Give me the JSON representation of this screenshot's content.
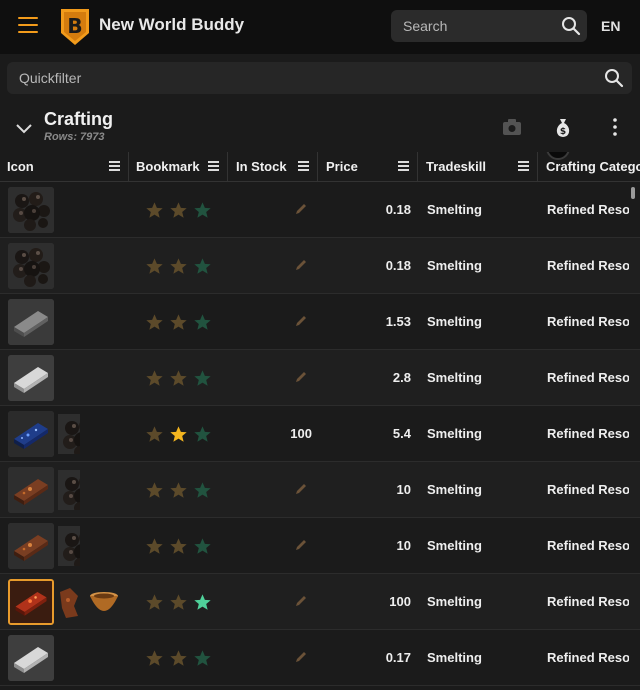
{
  "app": {
    "title": "New World Buddy",
    "lang": "EN",
    "search_placeholder": "Search",
    "quickfilter_placeholder": "Quickfilter",
    "accent": "#f29b1b"
  },
  "section": {
    "title": "Crafting",
    "rows_text": "Rows: 7973"
  },
  "columns": [
    {
      "label": "Icon"
    },
    {
      "label": "Bookmark"
    },
    {
      "label": "In Stock"
    },
    {
      "label": "Price"
    },
    {
      "label": "Tradeskill"
    },
    {
      "label": "Crafting Category"
    }
  ],
  "rows": [
    {
      "icon": "charcoal-icon",
      "sub": [],
      "stock": "",
      "price": "0.18",
      "tradeskill": "Smelting",
      "category": "Refined Resources",
      "bookmark": 0
    },
    {
      "icon": "charcoal-icon",
      "sub": [],
      "stock": "",
      "price": "0.18",
      "tradeskill": "Smelting",
      "category": "Refined Resources",
      "bookmark": 0
    },
    {
      "icon": "iron-ingot-icon",
      "sub": [],
      "stock": "",
      "price": "1.53",
      "tradeskill": "Smelting",
      "category": "Refined Resources",
      "bookmark": 0
    },
    {
      "icon": "silver-ingot-icon",
      "sub": [],
      "stock": "",
      "price": "2.8",
      "tradeskill": "Smelting",
      "category": "Refined Resources",
      "bookmark": 0
    },
    {
      "icon": "starmetal-ingot-icon",
      "sub": [
        "charcoal-icon"
      ],
      "stock": "100",
      "price": "5.4",
      "tradeskill": "Smelting",
      "category": "Refined Resources",
      "bookmark": 2
    },
    {
      "icon": "copper-ingot-icon",
      "sub": [
        "charcoal-icon"
      ],
      "stock": "",
      "price": "10",
      "tradeskill": "Smelting",
      "category": "Refined Resources",
      "bookmark": 0
    },
    {
      "icon": "copper-ingot-icon",
      "sub": [
        "charcoal-icon"
      ],
      "stock": "",
      "price": "10",
      "tradeskill": "Smelting",
      "category": "Refined Resources",
      "bookmark": 0
    },
    {
      "icon": "orichalcum-ingot-icon",
      "sub": [
        "ore-chunk-icon",
        "bowl-icon"
      ],
      "stock": "",
      "price": "100",
      "tradeskill": "Smelting",
      "category": "Refined Resources",
      "bookmark": 3,
      "selected": true
    },
    {
      "icon": "silver-ingot-icon",
      "sub": [],
      "stock": "",
      "price": "0.17",
      "tradeskill": "Smelting",
      "category": "Refined Resources",
      "bookmark": 0
    }
  ]
}
